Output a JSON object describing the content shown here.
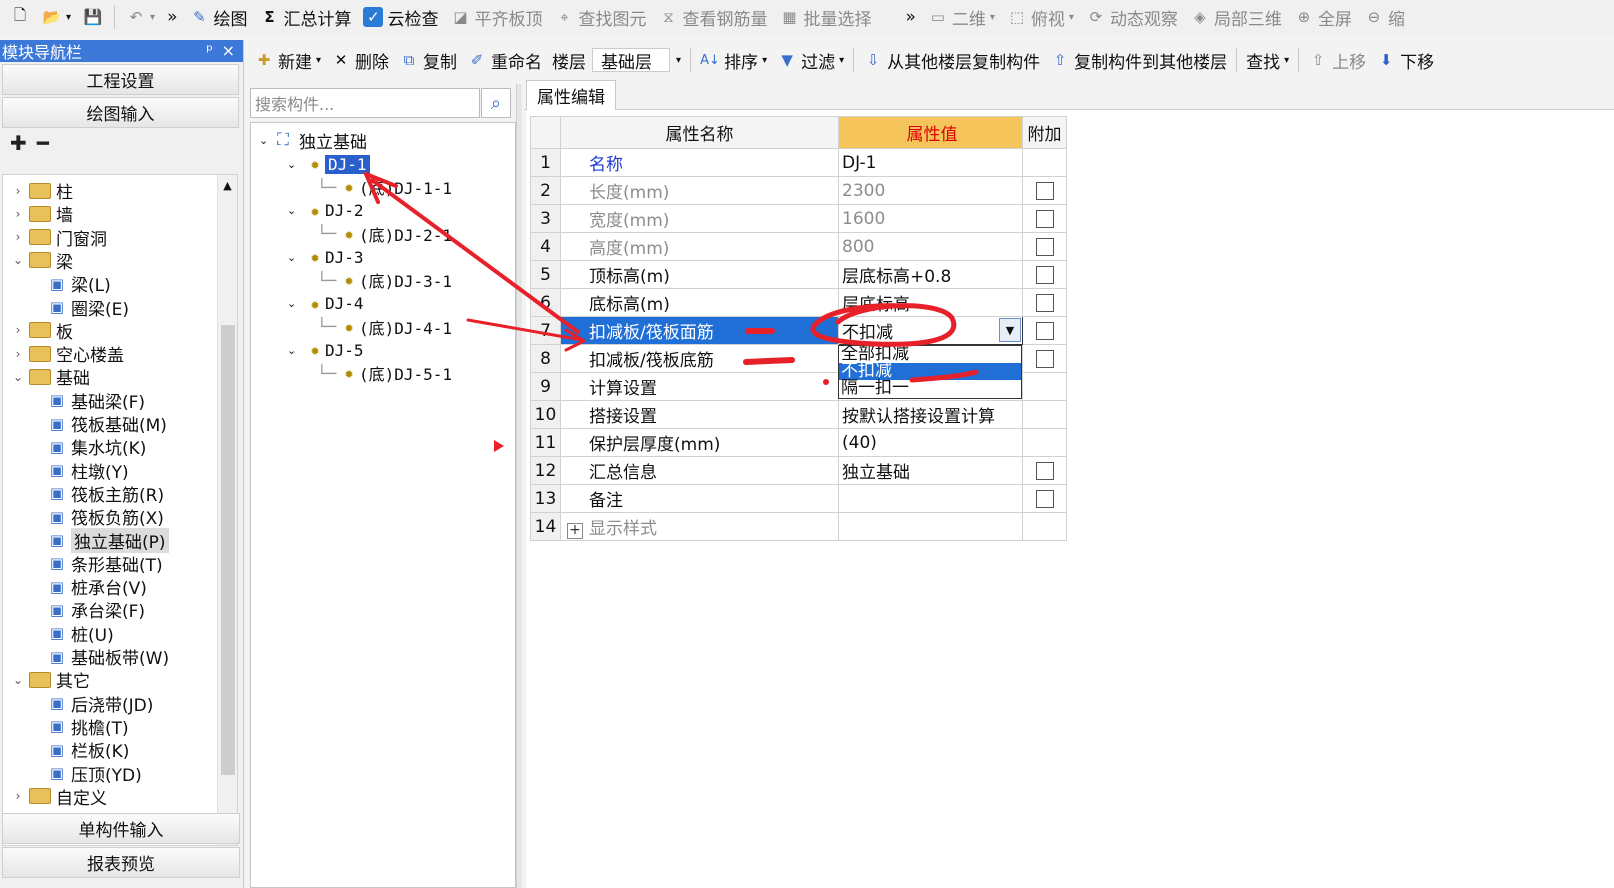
{
  "toolbar": {
    "items": [
      "绘图",
      "汇总计算",
      "云检查",
      "平齐板顶",
      "查找图元",
      "查看钢筋量",
      "批量选择",
      "二维",
      "俯视",
      "动态观察",
      "局部三维",
      "全屏",
      "缩"
    ],
    "more": "»"
  },
  "nav": {
    "title": "模块导航栏",
    "pin": "ᵖ",
    "close": "×",
    "top_buttons": [
      "工程设置",
      "绘图输入"
    ],
    "bottom_buttons": [
      "单构件输入",
      "报表预览"
    ],
    "expand_all": "✚",
    "collapse_all": "━",
    "tree": [
      {
        "label": "柱",
        "level": 0,
        "expander": "›"
      },
      {
        "label": "墙",
        "level": 0,
        "expander": "›"
      },
      {
        "label": "门窗洞",
        "level": 0,
        "expander": "›"
      },
      {
        "label": "梁",
        "level": 0,
        "expander": "⌄"
      },
      {
        "label": "梁(L)",
        "level": 1
      },
      {
        "label": "圈梁(E)",
        "level": 1
      },
      {
        "label": "板",
        "level": 0,
        "expander": "›"
      },
      {
        "label": "空心楼盖",
        "level": 0,
        "expander": "›"
      },
      {
        "label": "基础",
        "level": 0,
        "expander": "⌄"
      },
      {
        "label": "基础梁(F)",
        "level": 1
      },
      {
        "label": "筏板基础(M)",
        "level": 1
      },
      {
        "label": "集水坑(K)",
        "level": 1
      },
      {
        "label": "柱墩(Y)",
        "level": 1
      },
      {
        "label": "筏板主筋(R)",
        "level": 1
      },
      {
        "label": "筏板负筋(X)",
        "level": 1
      },
      {
        "label": "独立基础(P)",
        "level": 1
      },
      {
        "label": "条形基础(T)",
        "level": 1
      },
      {
        "label": "桩承台(V)",
        "level": 1
      },
      {
        "label": "承台梁(F)",
        "level": 1
      },
      {
        "label": "桩(U)",
        "level": 1
      },
      {
        "label": "基础板带(W)",
        "level": 1
      },
      {
        "label": "其它",
        "level": 0,
        "expander": "⌄"
      },
      {
        "label": "后浇带(JD)",
        "level": 1
      },
      {
        "label": "挑檐(T)",
        "level": 1
      },
      {
        "label": "栏板(K)",
        "level": 1
      },
      {
        "label": "压顶(YD)",
        "level": 1
      },
      {
        "label": "自定义",
        "level": 0,
        "expander": "›"
      }
    ]
  },
  "subtoolbar": {
    "new": "新建",
    "delete": "删除",
    "copy": "复制",
    "rename": "重命名",
    "layer_label": "楼层",
    "layer_value": "基础层",
    "sort": "排序",
    "filter": "过滤",
    "copy_from": "从其他楼层复制构件",
    "copy_to": "复制构件到其他楼层",
    "find": "查找",
    "up": "上移",
    "down": "下移"
  },
  "search": {
    "placeholder": "搜索构件...",
    "icon": "⌕"
  },
  "component_tree": {
    "root": "独立基础",
    "items": [
      {
        "name": "DJ-1",
        "child": "(底)DJ-1-1"
      },
      {
        "name": "DJ-2",
        "child": "(底)DJ-2-1"
      },
      {
        "name": "DJ-3",
        "child": "(底)DJ-3-1"
      },
      {
        "name": "DJ-4",
        "child": "(底)DJ-4-1"
      },
      {
        "name": "DJ-5",
        "child": "(底)DJ-5-1"
      }
    ]
  },
  "tab": {
    "label": "属性编辑"
  },
  "props": {
    "headers": {
      "name": "属性名称",
      "value": "属性值",
      "extra": "附加"
    },
    "rows": [
      {
        "no": "1",
        "name": "名称",
        "value": "DJ-1",
        "check": false
      },
      {
        "no": "2",
        "name": "长度(mm)",
        "value": "2300",
        "check": true
      },
      {
        "no": "3",
        "name": "宽度(mm)",
        "value": "1600",
        "check": true
      },
      {
        "no": "4",
        "name": "高度(mm)",
        "value": "800",
        "check": true
      },
      {
        "no": "5",
        "name": "顶标高(m)",
        "value": "层底标高+0.8",
        "check": true
      },
      {
        "no": "6",
        "name": "底标高(m)",
        "value": "层底标高",
        "check": true
      },
      {
        "no": "7",
        "name": "扣减板/筏板面筋",
        "value": "不扣减",
        "check": true
      },
      {
        "no": "8",
        "name": "扣减板/筏板底筋",
        "value": "",
        "check": true
      },
      {
        "no": "9",
        "name": "计算设置",
        "value": "",
        "check": false
      },
      {
        "no": "10",
        "name": "搭接设置",
        "value": "按默认搭接设置计算",
        "check": false
      },
      {
        "no": "11",
        "name": "保护层厚度(mm)",
        "value": "(40)",
        "check": false
      },
      {
        "no": "12",
        "name": "汇总信息",
        "value": "独立基础",
        "check": true
      },
      {
        "no": "13",
        "name": "备注",
        "value": "",
        "check": true
      },
      {
        "no": "14",
        "name": "显示样式",
        "value": "",
        "check": false
      }
    ],
    "expand_sign": "+"
  },
  "dropdown": {
    "options": [
      "全部扣减",
      "不扣减",
      "隔一扣一"
    ],
    "selected_index": 1
  },
  "colors": {
    "accent": "#1f6fd6",
    "header_highlight": "#f5c55c",
    "annotation": "#e8202a"
  }
}
